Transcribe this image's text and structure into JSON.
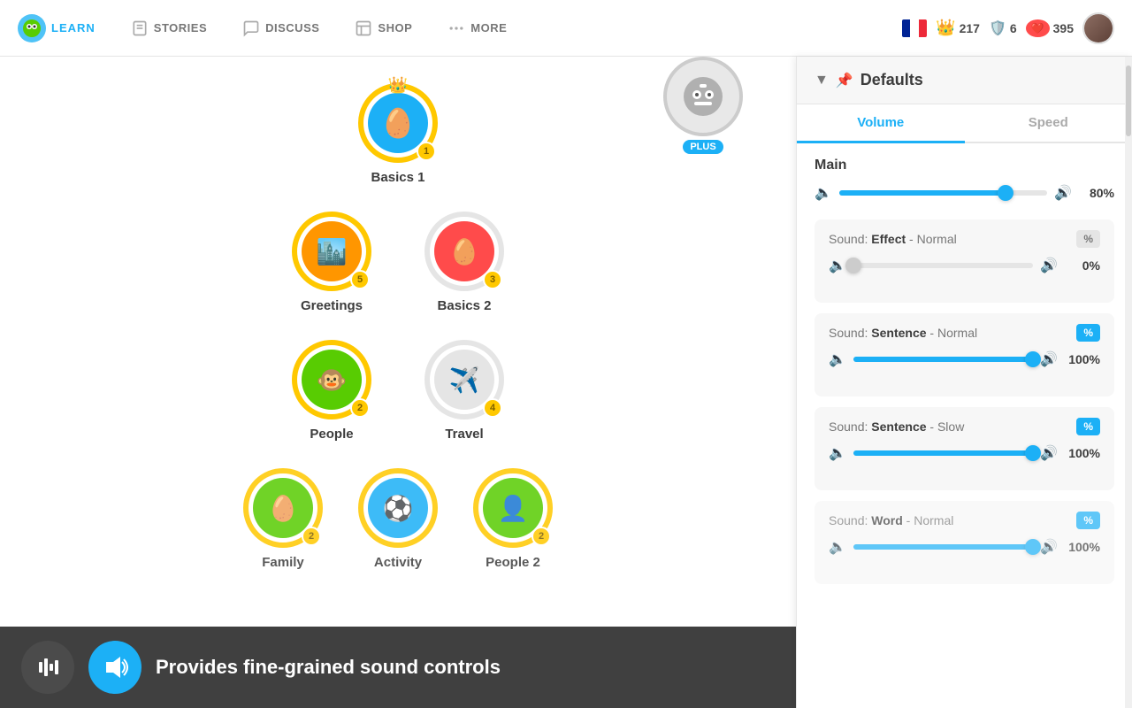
{
  "nav": {
    "brand": "LEARN",
    "items": [
      {
        "label": "STORIES",
        "icon": "book"
      },
      {
        "label": "DISCUSS",
        "icon": "chat"
      },
      {
        "label": "SHOP",
        "icon": "shop"
      },
      {
        "label": "MORE",
        "icon": "more"
      }
    ],
    "stats": {
      "streak": "217",
      "shield": "6",
      "hearts": "395"
    }
  },
  "plus": {
    "label": "PLUS"
  },
  "lessons": [
    {
      "id": "basics1",
      "label": "Basics 1",
      "level": 1,
      "color": "blue",
      "ring": "yellow",
      "emoji": "🥚",
      "crown": true,
      "single": true
    },
    {
      "id": "greetings",
      "label": "Greetings",
      "level": 5,
      "color": "orange",
      "ring": "yellow",
      "emoji": "🏙️",
      "single": false
    },
    {
      "id": "basics2",
      "label": "Basics 2",
      "level": 3,
      "color": "red",
      "ring": "gray",
      "emoji": "🥚",
      "single": false
    },
    {
      "id": "people",
      "label": "People",
      "level": 2,
      "color": "green",
      "ring": "yellow",
      "emoji": "🐵",
      "single": false
    },
    {
      "id": "travel",
      "label": "Travel",
      "level": 4,
      "color": "gray",
      "ring": "gray",
      "emoji": "✈️",
      "single": false
    },
    {
      "id": "family",
      "label": "Family",
      "level": 2,
      "color": "green",
      "ring": "yellow",
      "emoji": "🥚",
      "single": false
    },
    {
      "id": "activity",
      "label": "Activity",
      "level": 0,
      "color": "blue-dark",
      "ring": "yellow",
      "emoji": "⚽",
      "single": false
    },
    {
      "id": "people2",
      "label": "People 2",
      "level": 2,
      "color": "green",
      "ring": "yellow",
      "emoji": "👤",
      "single": false
    }
  ],
  "tooltip": {
    "text": "Provides fine-grained sound controls"
  },
  "panel": {
    "title": "Defaults",
    "tabs": [
      "Volume",
      "Speed"
    ],
    "active_tab": "Volume",
    "main_label": "Main",
    "main_value": "80%",
    "main_pct": 0.8,
    "sections": [
      {
        "label": "Effect",
        "modifier": "Normal",
        "value": "0%",
        "pct": 0.0,
        "badge_active": false
      },
      {
        "label": "Sentence",
        "modifier": "Normal",
        "value": "100%",
        "pct": 1.0,
        "badge_active": true
      },
      {
        "label": "Sentence",
        "modifier": "Slow",
        "value": "100%",
        "pct": 1.0,
        "badge_active": true
      },
      {
        "label": "Word",
        "modifier": "Normal",
        "value": "100%",
        "pct": 1.0,
        "badge_active": true
      }
    ]
  }
}
